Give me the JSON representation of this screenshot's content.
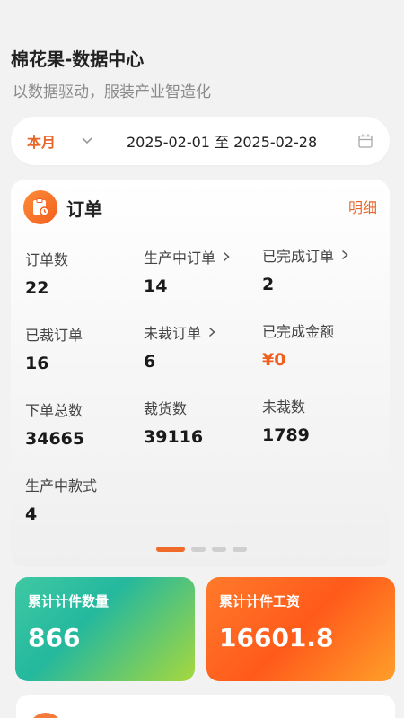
{
  "header": {
    "title": "棉花果-数据中心",
    "subtitle": "以数据驱动，服装产业智造化"
  },
  "filter": {
    "period": "本月",
    "date_range": "2025-02-01 至 2025-02-28",
    "icons": {
      "period": "chevron-down-icon",
      "date": "calendar-icon"
    }
  },
  "orders": {
    "title": "订单",
    "detail_link": "明细",
    "icon": "order-clipboard-icon",
    "stats": [
      {
        "label": "订单数",
        "value": "22"
      },
      {
        "label": "生产中订单",
        "value": "14"
      },
      {
        "label": "已完成订单",
        "value": "2"
      },
      {
        "label": "已裁订单",
        "value": "16"
      },
      {
        "label": "未裁订单",
        "value": "6"
      },
      {
        "label": "已完成金额",
        "value": "¥0"
      },
      {
        "label": "下单总数",
        "value": "34665"
      },
      {
        "label": "裁货数",
        "value": "39116"
      },
      {
        "label": "未裁数",
        "value": "1789"
      },
      {
        "label": "生产中款式",
        "value": "4"
      }
    ]
  },
  "carousel": {
    "page_count": 4,
    "active_index": 0
  },
  "metrics": [
    {
      "label": "累计计件数量",
      "value": "866"
    },
    {
      "label": "累计计件工资",
      "value": "16601.8"
    }
  ],
  "colors": {
    "accent": "#e8662a",
    "green_card": "#24b89e",
    "orange_card": "#ff5a1a",
    "page_bg": "#f2f2f3"
  }
}
